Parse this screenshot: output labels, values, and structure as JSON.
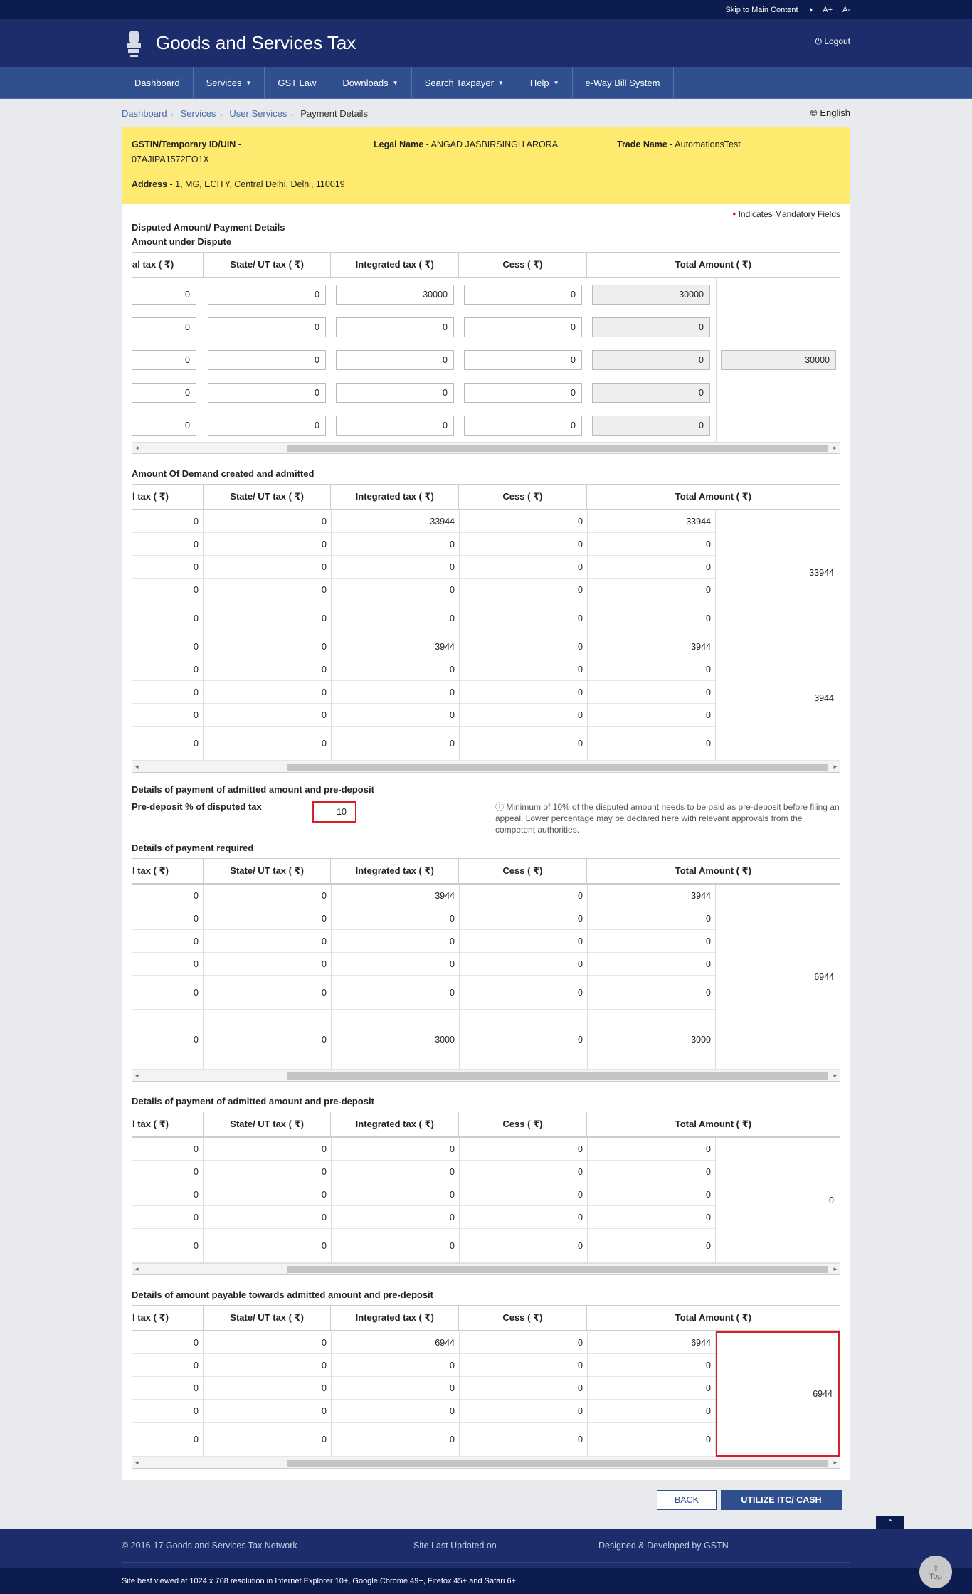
{
  "topbar": {
    "skip": "Skip to Main Content",
    "contrast_icon": "contrast-icon",
    "font_plus": "A+",
    "font_minus": "A-"
  },
  "header": {
    "title": "Goods and Services Tax",
    "logout": "Logout"
  },
  "nav": {
    "items": [
      "Dashboard",
      "Services",
      "GST Law",
      "Downloads",
      "Search Taxpayer",
      "Help",
      "e-Way Bill System"
    ],
    "dropdown": [
      "Services",
      "Downloads",
      "Search Taxpayer",
      "Help"
    ]
  },
  "breadcrumb": {
    "items": [
      "Dashboard",
      "Services",
      "User Services"
    ],
    "current": "Payment Details",
    "language": "English"
  },
  "info": {
    "gstin_label": "GSTIN/Temporary ID/UIN",
    "gstin_value": "07AJIPA1572EO1X",
    "legal_label": "Legal Name",
    "legal_value": "ANGAD JASBIRSINGH ARORA",
    "trade_label": "Trade Name",
    "trade_value": "AutomationsTest",
    "address_label": "Address",
    "address_value": "1, MG, ECITY, Central Delhi, Delhi, 110019"
  },
  "mandatory": "Indicates Mandatory Fields",
  "columns": [
    "al tax ( ₹)",
    "State/ UT tax ( ₹)",
    "Integrated tax ( ₹)",
    "Cess ( ₹)",
    "Total Amount ( ₹)"
  ],
  "columns_short": [
    "l tax ( ₹)",
    "State/ UT tax ( ₹)",
    "Integrated tax ( ₹)",
    "Cess ( ₹)",
    "Total Amount ( ₹)"
  ],
  "section1": {
    "title": "Disputed Amount/ Payment Details",
    "subtitle": "Amount under Dispute",
    "rows": [
      [
        "0",
        "0",
        "30000",
        "0",
        "30000"
      ],
      [
        "0",
        "0",
        "0",
        "0",
        "0"
      ],
      [
        "0",
        "0",
        "0",
        "0",
        "0"
      ],
      [
        "0",
        "0",
        "0",
        "0",
        "0"
      ],
      [
        "0",
        "0",
        "0",
        "0",
        "0"
      ]
    ],
    "total": "30000"
  },
  "section2": {
    "title": "Amount Of Demand created and admitted",
    "groupA": [
      [
        "0",
        "0",
        "33944",
        "0",
        "33944"
      ],
      [
        "0",
        "0",
        "0",
        "0",
        "0"
      ],
      [
        "0",
        "0",
        "0",
        "0",
        "0"
      ],
      [
        "0",
        "0",
        "0",
        "0",
        "0"
      ],
      [
        "0",
        "0",
        "0",
        "0",
        "0"
      ]
    ],
    "totalA": "33944",
    "groupB": [
      [
        "0",
        "0",
        "3944",
        "0",
        "3944"
      ],
      [
        "0",
        "0",
        "0",
        "0",
        "0"
      ],
      [
        "0",
        "0",
        "0",
        "0",
        "0"
      ],
      [
        "0",
        "0",
        "0",
        "0",
        "0"
      ],
      [
        "0",
        "0",
        "0",
        "0",
        "0"
      ]
    ],
    "totalB": "3944"
  },
  "predeposit": {
    "title": "Details of payment of admitted amount and pre-deposit",
    "label": "Pre-deposit % of disputed tax",
    "value": "10",
    "note": "Minimum of 10% of the disputed amount needs to be paid as pre-deposit before filing an appeal. Lower percentage may be declared here with relevant approvals from the competent authorities."
  },
  "section3": {
    "title": "Details of payment required",
    "rows": [
      [
        "0",
        "0",
        "3944",
        "0",
        "3944"
      ],
      [
        "0",
        "0",
        "0",
        "0",
        "0"
      ],
      [
        "0",
        "0",
        "0",
        "0",
        "0"
      ],
      [
        "0",
        "0",
        "0",
        "0",
        "0"
      ],
      [
        "0",
        "0",
        "0",
        "0",
        "0"
      ],
      [
        "0",
        "0",
        "3000",
        "0",
        "3000"
      ]
    ],
    "total": "6944"
  },
  "section4": {
    "title": "Details of payment of admitted amount and pre-deposit",
    "rows": [
      [
        "0",
        "0",
        "0",
        "0",
        "0"
      ],
      [
        "0",
        "0",
        "0",
        "0",
        "0"
      ],
      [
        "0",
        "0",
        "0",
        "0",
        "0"
      ],
      [
        "0",
        "0",
        "0",
        "0",
        "0"
      ],
      [
        "0",
        "0",
        "0",
        "0",
        "0"
      ]
    ],
    "total": "0"
  },
  "section5": {
    "title": "Details of amount payable towards admitted amount and pre-deposit",
    "rows": [
      [
        "0",
        "0",
        "6944",
        "0",
        "6944"
      ],
      [
        "0",
        "0",
        "0",
        "0",
        "0"
      ],
      [
        "0",
        "0",
        "0",
        "0",
        "0"
      ],
      [
        "0",
        "0",
        "0",
        "0",
        "0"
      ],
      [
        "0",
        "0",
        "0",
        "0",
        "0"
      ]
    ],
    "total": "6944"
  },
  "buttons": {
    "back": "BACK",
    "utilize": "UTILIZE ITC/ CASH"
  },
  "footer": {
    "copyright": "© 2016-17 Goods and Services Tax Network",
    "updated": "Site Last Updated on",
    "designed": "Designed & Developed by GSTN",
    "best": "Site best viewed at 1024 x 768 resolution in Internet Explorer 10+, Google Chrome 49+, Firefox 45+ and Safari 6+",
    "top": "Top"
  },
  "colors": {
    "header": "#1d2d6b",
    "nav": "#2f4f8e",
    "info": "#fdea6f",
    "highlight": "#d81f26"
  }
}
